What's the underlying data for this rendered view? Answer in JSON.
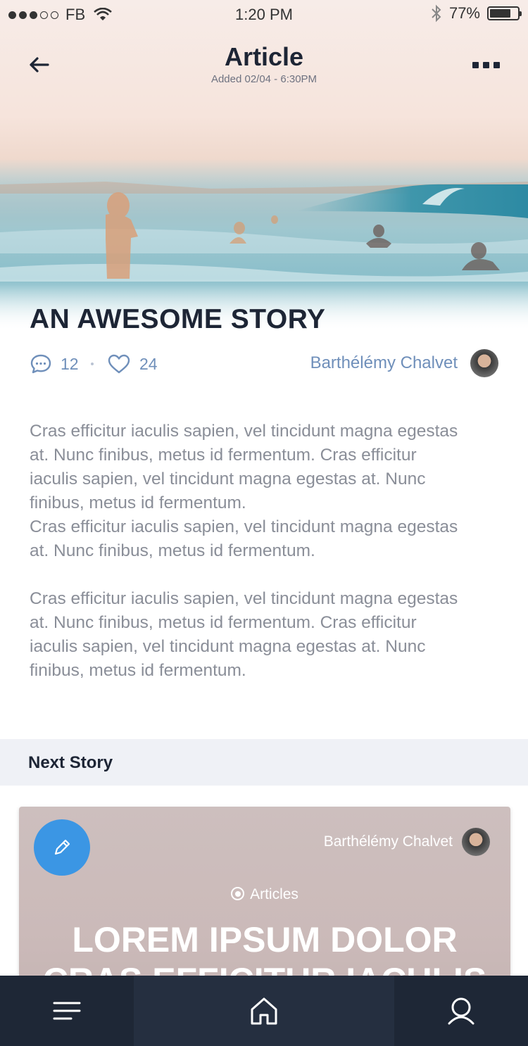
{
  "status_bar": {
    "carrier": "FB",
    "time": "1:20 PM",
    "battery": "77%",
    "battery_level": 0.77,
    "signal_bars_filled": 3,
    "signal_bars_total": 5
  },
  "nav": {
    "title": "Article",
    "subtitle": "Added 02/04 - 6:30PM",
    "back_icon": "arrow-left-icon",
    "more_icon": "more-icon"
  },
  "article": {
    "title": "AN AWESOME STORY",
    "comments_count": "12",
    "likes_count": "24",
    "author": "Barthélémy Chalvet",
    "paragraphs": [
      "Cras efficitur iaculis sapien, vel tincidunt magna egestas\nat. Nunc finibus, metus id fermentum. Cras efficitur\niaculis sapien, vel tincidunt magna egestas at. Nunc\nfinibus, metus id fermentum.\nCras efficitur iaculis sapien, vel tincidunt magna egestas\nat. Nunc finibus, metus id fermentum.",
      "Cras efficitur iaculis sapien, vel tincidunt magna egestas\nat. Nunc finibus, metus id fermentum. Cras efficitur\niaculis sapien, vel tincidunt magna egestas at. Nunc\nfinibus, metus id fermentum."
    ]
  },
  "next_story": {
    "header": "Next Story",
    "author": "Barthélémy Chalvet",
    "tag": "Articles",
    "headline": "LOREM IPSUM DOLOR\nCRAS EFFICITUR IACULIS"
  },
  "tabbar": {
    "items": [
      {
        "name": "menu",
        "icon": "menu-icon"
      },
      {
        "name": "home",
        "icon": "home-icon",
        "active": true
      },
      {
        "name": "search",
        "icon": "search-icon"
      }
    ]
  },
  "colors": {
    "text_dark": "#1d2535",
    "meta_blue": "#6f8fba",
    "body_gray": "#8a8e98",
    "accent_blue": "#3b96e4",
    "tabbar_bg": "#1e2736",
    "section_bg": "#eff1f6"
  }
}
